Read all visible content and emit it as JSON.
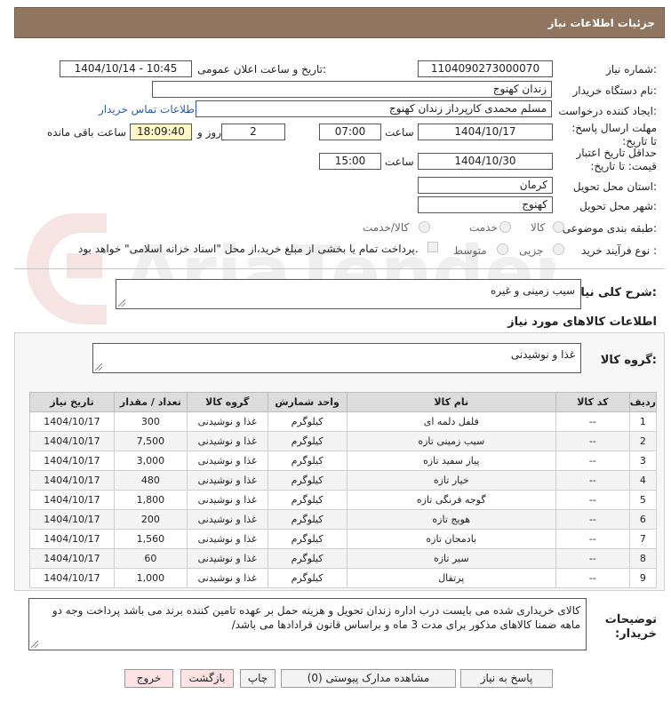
{
  "header": {
    "title": "جزئیات اطلاعات نیاز"
  },
  "form": {
    "need_number_label": "شماره نیاز:",
    "need_number": "1104090273000070",
    "announce_label": "تاریخ و ساعت اعلان عمومی:",
    "announce_value": "1404/10/14 - 10:45",
    "buyer_org_label": "نام دستگاه خریدار:",
    "buyer_org": "زندان کهنوج",
    "creator_label": "ایجاد کننده درخواست:",
    "creator": "مسلم محمدی کارپرداز زندان کهنوج",
    "contact_link": "اطلاعات تماس خریدار",
    "deadline_label": "مهلت ارسال پاسخ: تا تاریخ:",
    "deadline_date": "1404/10/17",
    "time_label": "ساعت",
    "deadline_time": "07:00",
    "days_value": "2",
    "days_label": "روز و",
    "remaining_time": "18:09:40",
    "remaining_label": "ساعت باقی مانده",
    "validity_label": "حداقل تاریخ اعتبار قیمت: تا تاریخ:",
    "validity_date": "1404/10/30",
    "validity_time": "15:00",
    "province_label": "استان محل تحویل:",
    "province": "کرمان",
    "city_label": "شهر محل تحویل:",
    "city": "کهنوج",
    "category_label": "طبقه بندی موضوعی:",
    "category_options": [
      "کالا",
      "خدمت",
      "کالا/خدمت"
    ],
    "process_label": "نوع فرآیند خرید :",
    "process_options": [
      "جزیی",
      "متوسط"
    ],
    "payment_note": "پرداخت تمام یا بخشی از مبلغ خرید،از محل \"اسناد خزانه اسلامی\" خواهد بود."
  },
  "description": {
    "label": "شرح کلی نیاز:",
    "value": "سیب زمینی و غیره"
  },
  "goods_section": {
    "title": "اطلاعات کالاهای مورد نیاز",
    "group_label": "گروه کالا:",
    "group_value": "غذا و نوشیدنی"
  },
  "table": {
    "headers": [
      "ردیف",
      "کد کالا",
      "نام کالا",
      "واحد شمارش",
      "گروه کالا",
      "تعداد / مقدار",
      "تاریخ نیاز"
    ],
    "rows": [
      [
        "1",
        "--",
        "فلفل دلمه ای",
        "کیلوگرم",
        "غذا و نوشیدنی",
        "300",
        "1404/10/17"
      ],
      [
        "2",
        "--",
        "سیب زمینی تازه",
        "کیلوگرم",
        "غذا و نوشیدنی",
        "7,500",
        "1404/10/17"
      ],
      [
        "3",
        "--",
        "پیاز سفید تازه",
        "کیلوگرم",
        "غذا و نوشیدنی",
        "3,000",
        "1404/10/17"
      ],
      [
        "4",
        "--",
        "خیار تازه",
        "کیلوگرم",
        "غذا و نوشیدنی",
        "480",
        "1404/10/17"
      ],
      [
        "5",
        "--",
        "گوجه فرنگی تازه",
        "کیلوگرم",
        "غذا و نوشیدنی",
        "1,800",
        "1404/10/17"
      ],
      [
        "6",
        "--",
        "هویج تازه",
        "کیلوگرم",
        "غذا و نوشیدنی",
        "200",
        "1404/10/17"
      ],
      [
        "7",
        "--",
        "بادمجان تازه",
        "کیلوگرم",
        "غذا و نوشیدنی",
        "1,560",
        "1404/10/17"
      ],
      [
        "8",
        "--",
        "سیر تازه",
        "کیلوگرم",
        "غذا و نوشیدنی",
        "60",
        "1404/10/17"
      ],
      [
        "9",
        "--",
        "پرتقال",
        "کیلوگرم",
        "غذا و نوشیدنی",
        "1,000",
        "1404/10/17"
      ]
    ]
  },
  "buyer_notes": {
    "label": "توضیحات خریدار:",
    "value": "کالای خریداری شده می بایست درب اداره زندان تحویل و هزینه حمل بر عهده تامین کننده برند می باشد پرداخت وجه دو ماهه ضمنا کالاهای مذکور برای مدت 3 ماه و براساس قانون قرادادها می باشد/"
  },
  "buttons": {
    "reply": "پاسخ به نیاز",
    "attachments": "مشاهده مدارک پیوستی (0)",
    "print": "چاپ",
    "back": "بازگشت",
    "exit": "خروج"
  },
  "watermark": {
    "text": "AriaTender.net"
  }
}
